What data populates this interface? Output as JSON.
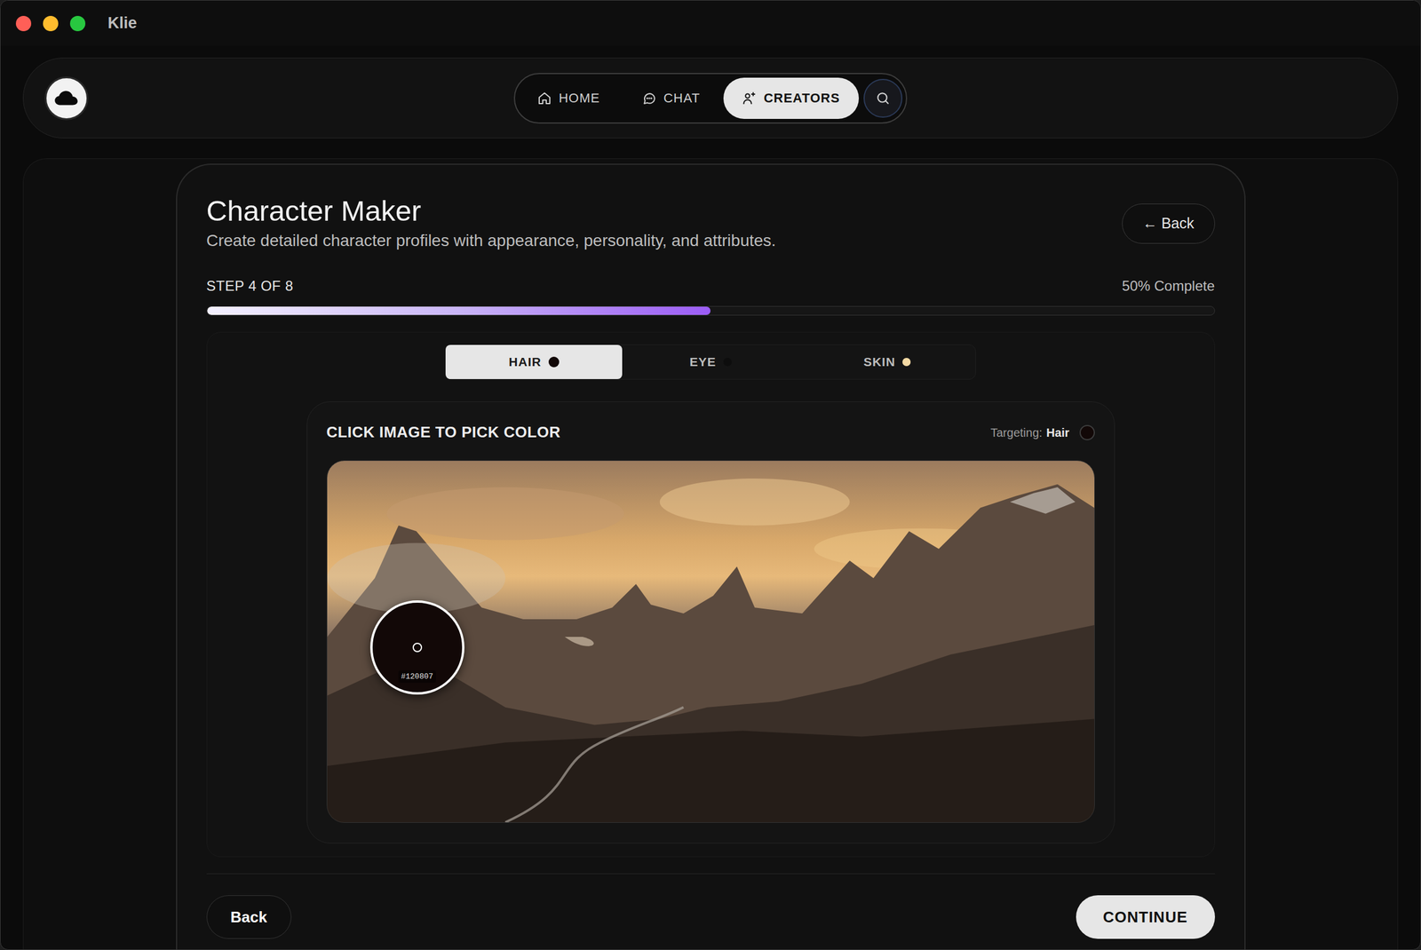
{
  "window": {
    "title": "Klie"
  },
  "nav": {
    "items": [
      {
        "label": "HOME",
        "selected": false
      },
      {
        "label": "CHAT",
        "selected": false
      },
      {
        "label": "CREATORS",
        "selected": true
      }
    ]
  },
  "page": {
    "title": "Character Maker",
    "subtitle": "Create detailed character profiles with appearance, personality, and attributes.",
    "back_button": "← Back"
  },
  "progress": {
    "step": "STEP 4 OF 8",
    "percent": "50% Complete",
    "level": 0.5
  },
  "tabs": [
    {
      "label": "HAIR",
      "selected": true,
      "color": "#120807"
    },
    {
      "label": "EYE",
      "selected": false,
      "color": "#0d0d0d"
    },
    {
      "label": "SKIN",
      "selected": false,
      "color": "#f3d9a4"
    }
  ],
  "picker": {
    "heading": "CLICK IMAGE TO PICK COLOR",
    "targeting_label": "Targeting:",
    "targeting_value": "Hair",
    "targeting_color": "#120807",
    "sample_hex": "#120807"
  },
  "footer": {
    "back": "Back",
    "continue": "CONTINUE"
  }
}
